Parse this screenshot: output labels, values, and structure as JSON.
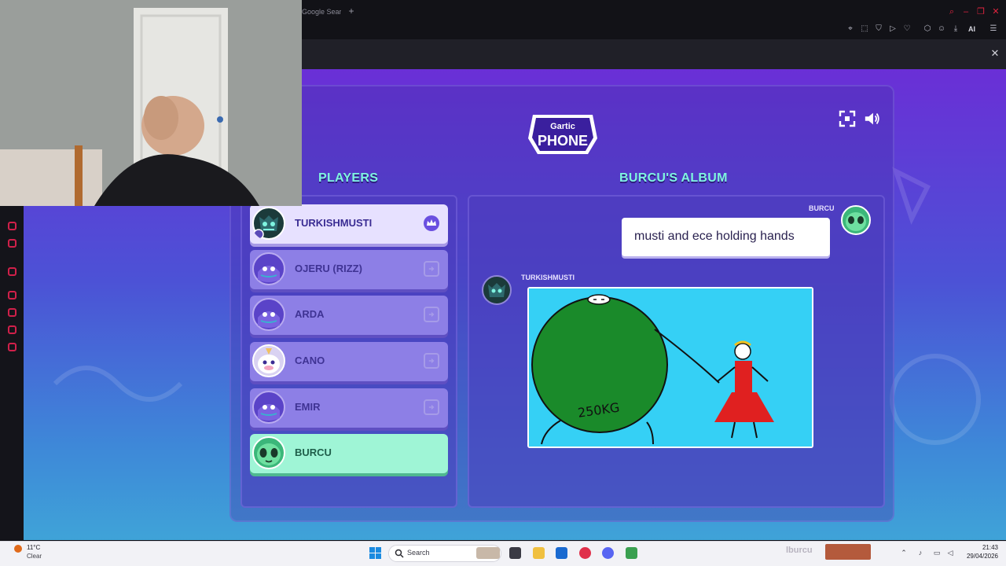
{
  "browser": {
    "tab_title": "Google Sear",
    "new_tab": "+",
    "ai_label": "AI",
    "close_overlay": "✕"
  },
  "game": {
    "logo_top": "Gartic",
    "logo_bottom": "PHONE",
    "players_heading": "PLAYERS",
    "album_heading": "BURCU'S ALBUM",
    "players": [
      {
        "name": "TURKISHMUSTI",
        "role": "host"
      },
      {
        "name": "OJERU (RIZZ)",
        "role": "idle"
      },
      {
        "name": "ARDA",
        "role": "idle"
      },
      {
        "name": "CANO",
        "role": "idle"
      },
      {
        "name": "EMIR",
        "role": "idle"
      },
      {
        "name": "BURCU",
        "role": "me"
      }
    ],
    "album": {
      "prompt_author": "BURCU",
      "prompt_text": "musti and ece holding hands",
      "drawing_author": "TURKISHMUSTI",
      "drawing_text": "250KG"
    }
  },
  "taskbar": {
    "weather_temp": "11°C",
    "weather_desc": "Clear",
    "search_label": "Search",
    "tray_text": "lburcu",
    "time": "21:43",
    "date": "29/04/2026"
  },
  "colors": {
    "accent_mint": "#7ff4e0",
    "purple_panel": "#4c3cbe",
    "drawing_bg": "#35d0f5",
    "blob_green": "#1a8a2a"
  }
}
